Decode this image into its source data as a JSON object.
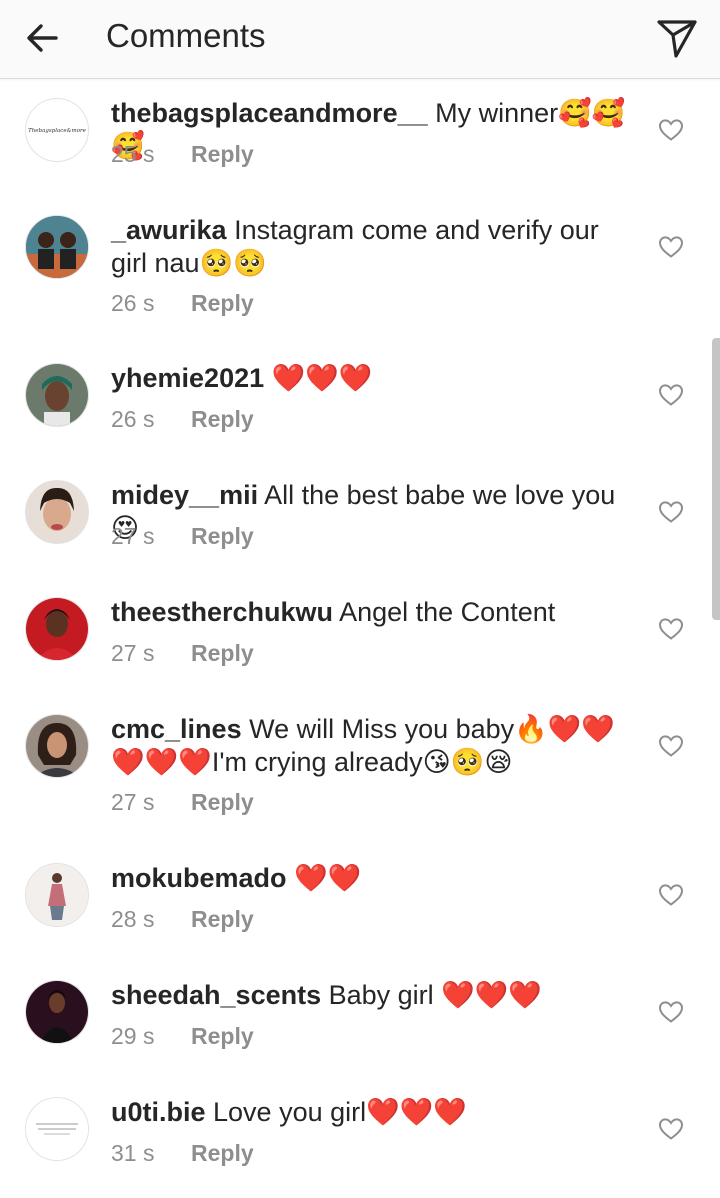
{
  "header": {
    "title": "Comments"
  },
  "reply_label": "Reply",
  "comments": [
    {
      "user": "thebagsplaceandmore__",
      "text": " My winner🥰🥰🥰",
      "time": "25 s",
      "avatar": "logo",
      "logo_text": "Thebagsplace&more"
    },
    {
      "user": "_awurika",
      "text": " Instagram come and verify our girl nau🥺🥺",
      "time": "26 s",
      "avatar": "duo"
    },
    {
      "user": "yhemie2021",
      "text": " ❤️❤️❤️",
      "time": "26 s",
      "avatar": "person"
    },
    {
      "user": "midey__mii",
      "text": " All the best babe we love you 😍",
      "time": "27 s",
      "avatar": "face"
    },
    {
      "user": "theestherchukwu",
      "text": " Angel the Content",
      "time": "27 s",
      "avatar": "red"
    },
    {
      "user": "cmc_lines",
      "text": " We will Miss you baby🔥❤️❤️❤️❤️❤️I'm crying already😘🥺😪",
      "time": "27 s",
      "avatar": "glam"
    },
    {
      "user": "mokubemado",
      "text": " ❤️❤️",
      "time": "28 s",
      "avatar": "full"
    },
    {
      "user": "sheedah_scents",
      "text": " Baby girl ❤️❤️❤️",
      "time": "29 s",
      "avatar": "dark"
    },
    {
      "user": "u0ti.bie",
      "text": " Love you girl❤️❤️❤️",
      "time": "31 s",
      "avatar": "note"
    }
  ]
}
